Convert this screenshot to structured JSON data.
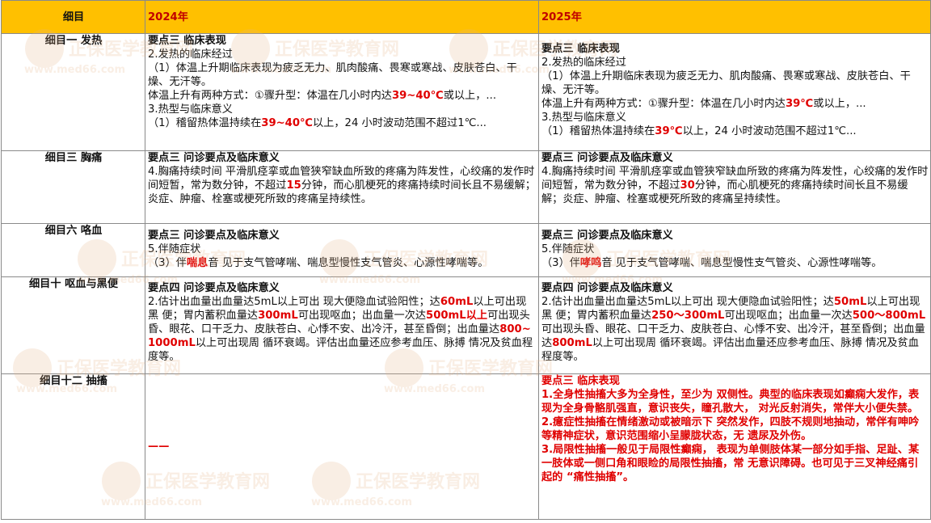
{
  "header": {
    "col0": "细目",
    "col1": "2024年",
    "col2": "2025年"
  },
  "rows": [
    {
      "category": "细目一  发热",
      "y2024": {
        "title": "要点三  临床表现",
        "l1": "2.发热的临床经过",
        "l2": "（1）体温上升期临床表现为疲乏无力、肌肉酸痛、畏寒或寒战、皮肤苍白、干燥、无汗等。",
        "l3a": "体温上升有两种方式：①骤升型：体温在几小时内达",
        "l3r": "39~40℃",
        "l3b": "或以上，...",
        "l4": "3.热型与临床意义",
        "l5a": "（1）稽留热体温持续在",
        "l5r": "39~40℃",
        "l5b": "以上，24 小时波动范围不超过1℃..."
      },
      "y2025": {
        "title": "要点三  临床表现",
        "l1": "2.发热的临床经过",
        "l2": "（1）体温上升期临床表现为疲乏无力、肌肉酸痛、畏寒或寒战、皮肤苍白、干燥、无汗等。",
        "l3a": "体温上升有两种方式：①骤升型：体温在几小时内达",
        "l3r": "39℃",
        "l3b": "或以上，...",
        "l4": "3.热型与临床意义",
        "l5a": "（1）稽留热体温持续在",
        "l5r": "39℃",
        "l5b": "以上，24 小时波动范围不超过1℃..."
      }
    },
    {
      "category": "细目三  胸痛",
      "y2024": {
        "title": "要点三  问诊要点及临床意义",
        "a": "4.胸痛持续时间 平滑肌痉挛或血管狭窄缺血所致的疼痛为阵发性，心绞痛的发作时间短暂，常为数分钟，不超过",
        "r": "15",
        "b": "分钟，而心肌梗死的疼痛持续时间长且不易缓解；炎症、肿瘤、栓塞或梗死所致的疼痛呈持续性。"
      },
      "y2025": {
        "title": "要点三  问诊要点及临床意义",
        "a": "4.胸痛持续时间 平滑肌痉挛或血管狭窄缺血所致的疼痛为阵发性，心绞痛的发作时间短暂，常为数分钟，不超过",
        "r": "30",
        "b": "分钟，而心肌梗死的疼痛持续时间长且不易缓解；炎症、肿瘤、栓塞或梗死所致的疼痛呈持续性。"
      }
    },
    {
      "category": "细目六  咯血",
      "y2024": {
        "title": "要点三  问诊要点及临床意义",
        "l1": "5.伴随症状",
        "a": "（3）伴",
        "r": "喘息",
        "b": "音 见于支气管哮喘、喘息型慢性支气管炎、心源性哮喘等。"
      },
      "y2025": {
        "title": "要点三  问诊要点及临床意义",
        "l1": "5.伴随症状",
        "a": "（3）伴",
        "r": "哮鸣",
        "b": "音 见于支气管哮喘、喘息型慢性支气管炎、心源性哮喘等。"
      }
    },
    {
      "category": "细目十  呕血与黑便",
      "y2024": {
        "title": "要点四  问诊要点及临床意义",
        "a": "2.估计出血量出血量达5mL以上可出 现大便隐血试验阳性；达",
        "r1": "60mL",
        "b": "以上可出现黑 便；胃内蓄积血量达",
        "r2": "300mL",
        "c": "可出现呕血；出血量一次达",
        "r3": "500mL以上",
        "d": "可出现头昏、眼花、口干乏力、皮肤苍白、心悸不安、出冷汗，甚至昏倒；出血量达",
        "r4": "800~1000mL",
        "e": "以上可出现周 循环衰竭。评估出血量还应参考血压、脉搏 情况及贫血程度等。"
      },
      "y2025": {
        "title": "要点四  问诊要点及临床意义",
        "a": "2.估计出血量出血量达5mL以上可出 现大便隐血试验阳性；达",
        "r1": "50mL",
        "b": "以上可出现黑 便；胃内蓄积血量达",
        "r2": "250～300mL",
        "c": "可出现呕血；出血量一次达",
        "r3": "500～800mL",
        "d": "可出现头昏、眼花、口干乏力、皮肤苍白、心悸不安、出冷汗，甚至昏倒；出血量达",
        "r4": "800mL",
        "e": "以上可出现周 循环衰竭。评估出血量还应参考血压、脉搏 情况及贫血程度等。"
      }
    },
    {
      "category": "细目十二  抽搐",
      "y2024": {
        "text": "——"
      },
      "y2025": {
        "title": "要点三  临床表现",
        "p1": "1.全身性抽搐大多为全身性，至少为 双侧性。典型的临床表现如癫痫大发作，表 现为全身骨骼肌强直，意识丧失，瞳孔散大， 对光反射消失，常伴大小便失禁。",
        "p2": "2.癔症性抽搐在情绪激动或被暗示下 突然发作，四肢不规则地抽动，常伴有呻吟 等精神症状，意识范围缩小呈朦胧状态，无 遗尿及外伤。",
        "p3": "3.局限性抽搐一般见于局限性癫痫， 表现为单侧肢体某一部分如手指、足趾、某 一肢体或一侧口角和眼睑的局限性抽搐，常 无意识障碍。也可见于三叉神经痛引起的 “痛性抽搐”。"
      }
    }
  ],
  "watermark": {
    "brand": "正保医学教育网",
    "url": "www.med66.com"
  },
  "colors": {
    "header_bg": "#ffc000",
    "highlight": "#e00000",
    "border": "#8a8a8a"
  }
}
